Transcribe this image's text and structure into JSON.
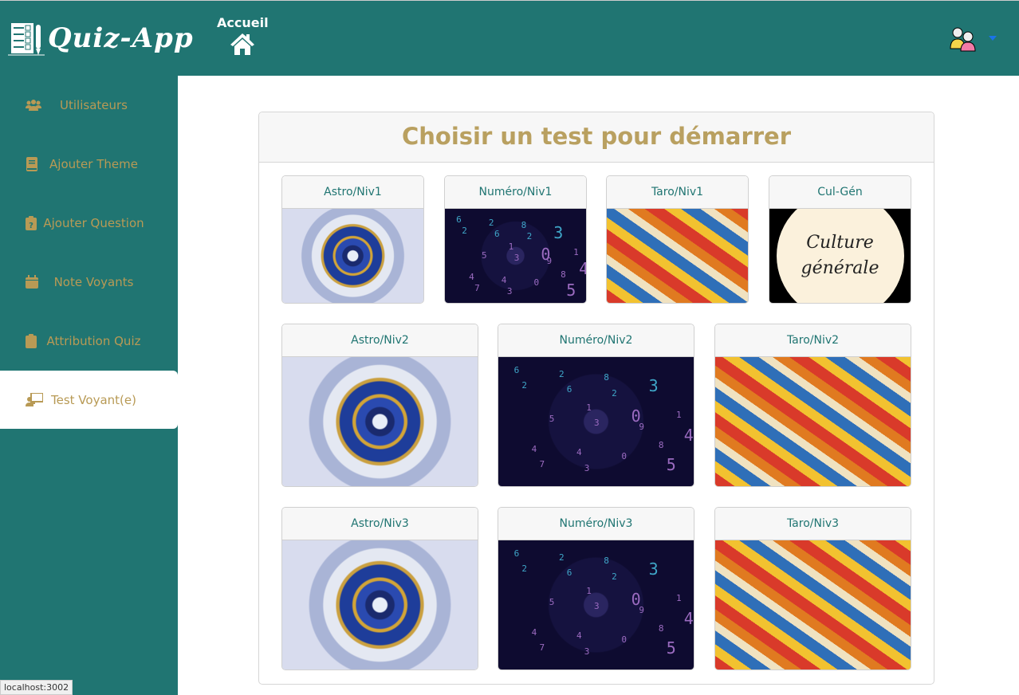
{
  "app": {
    "name": "Quiz-App"
  },
  "header": {
    "home_label": "Accueil"
  },
  "sidebar": {
    "items": [
      {
        "label": "Utilisateurs",
        "icon": "users-icon"
      },
      {
        "label": "Ajouter Theme",
        "icon": "book-icon"
      },
      {
        "label": "Ajouter Question",
        "icon": "clipboard-question-icon"
      },
      {
        "label": "Note Voyants",
        "icon": "calendar-icon"
      },
      {
        "label": "Attribution Quiz",
        "icon": "clipboard-icon"
      },
      {
        "label": "Test Voyant(e)",
        "icon": "teacher-icon",
        "active": true
      }
    ]
  },
  "main": {
    "title": "Choisir un test pour démarrer",
    "tests": [
      {
        "label": "Astro/Niv1",
        "image": "astro"
      },
      {
        "label": "Numéro/Niv1",
        "image": "numero"
      },
      {
        "label": "Taro/Niv1",
        "image": "taro"
      },
      {
        "label": "Cul-Gén",
        "image": "culture",
        "image_text": "Culture générale"
      },
      {
        "label": "Astro/Niv2",
        "image": "astro"
      },
      {
        "label": "Numéro/Niv2",
        "image": "numero"
      },
      {
        "label": "Taro/Niv2",
        "image": "taro"
      },
      {
        "label": "Astro/Niv3",
        "image": "astro"
      },
      {
        "label": "Numéro/Niv3",
        "image": "numero"
      },
      {
        "label": "Taro/Niv3",
        "image": "taro"
      }
    ]
  },
  "status_bar": {
    "url": "localhost:3002"
  },
  "colors": {
    "primary": "#207572",
    "accent": "#b89a55",
    "title": "#b9a060"
  }
}
